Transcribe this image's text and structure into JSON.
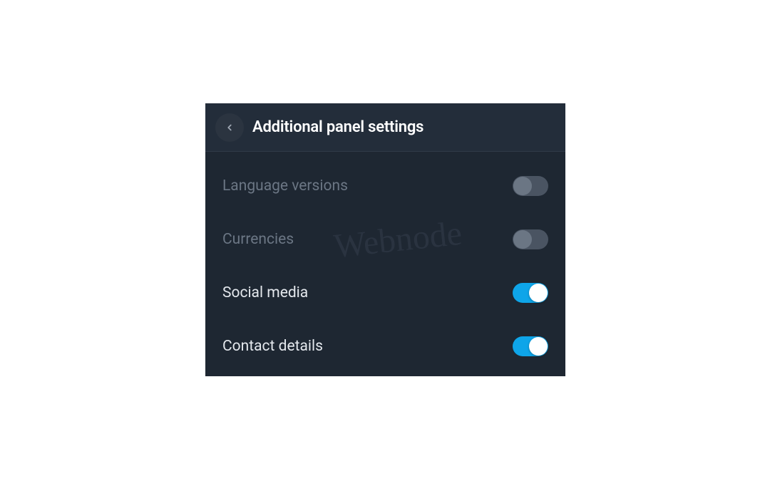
{
  "panel": {
    "title": "Additional panel settings",
    "watermark": "Webnode",
    "settings": [
      {
        "label": "Language versions",
        "enabled": false
      },
      {
        "label": "Currencies",
        "enabled": false
      },
      {
        "label": "Social media",
        "enabled": true
      },
      {
        "label": "Contact details",
        "enabled": true
      }
    ]
  }
}
